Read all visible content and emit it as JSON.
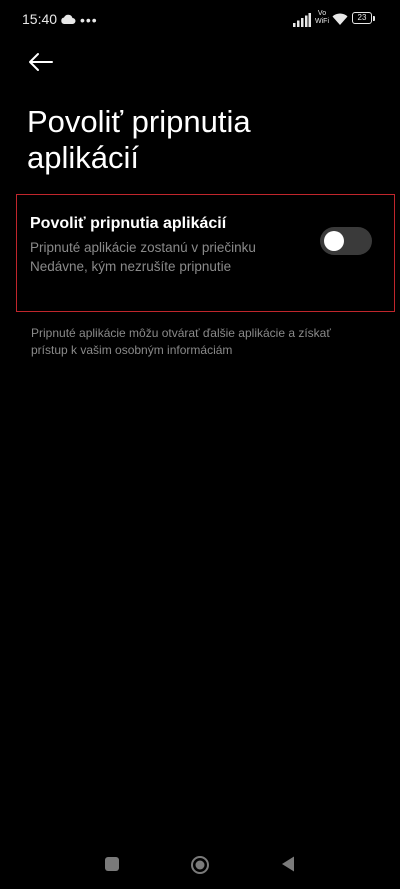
{
  "status_bar": {
    "time": "15:40",
    "network_label": "Vo\nWiFi",
    "battery_level": "23",
    "icons": [
      "cloud-icon",
      "more-dots-icon",
      "signal-icon",
      "vowifi-icon",
      "wifi-icon",
      "battery-icon"
    ]
  },
  "header": {
    "back_icon": "arrow-left-icon",
    "title": "Povoliť pripnutia aplikácií"
  },
  "setting": {
    "title": "Povoliť pripnutia aplikácií",
    "description": "Pripnuté aplikácie zostanú v priečinku Nedávne, kým nezrušíte pripnutie",
    "toggle_on": false,
    "highlight_color": "#c0262c"
  },
  "footer": {
    "note": "Pripnuté aplikácie môžu otvárať ďalšie aplikácie a získať prístup k vašim osobným informáciám"
  },
  "nav_bar": {
    "icons": [
      "recents-square-icon",
      "home-circle-icon",
      "back-triangle-icon"
    ]
  }
}
